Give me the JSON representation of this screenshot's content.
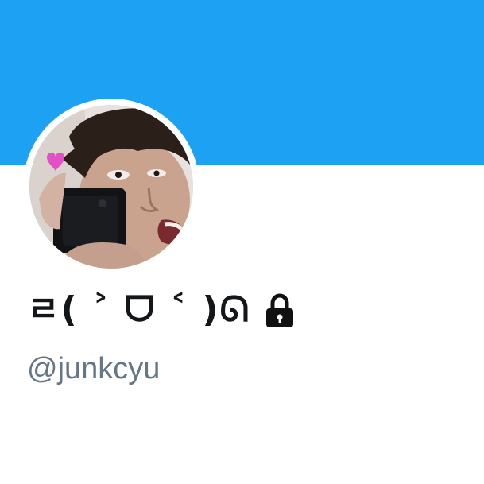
{
  "profile": {
    "display_name": "ㄹ( ˃ ᗜ ˂ )ᘏ",
    "handle": "@junkcyu",
    "protected": true,
    "lock_icon": "lock-icon"
  },
  "colors": {
    "banner": "#1da1f2",
    "name_text": "#14171a",
    "handle_text": "#657786",
    "background": "#ffffff"
  }
}
